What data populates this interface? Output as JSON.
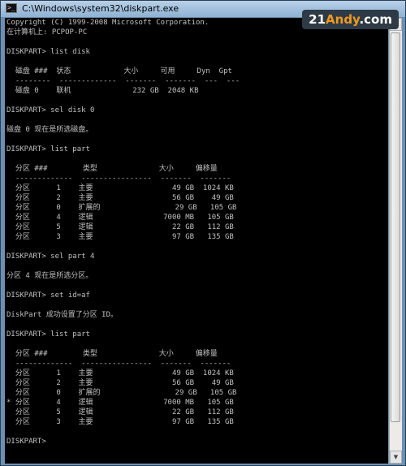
{
  "window": {
    "title": "C:\\Windows\\system32\\diskpart.exe",
    "icon": "cmd-console-icon"
  },
  "watermark": {
    "part1": "21",
    "part2": "Andy",
    "part3": ".com"
  },
  "console": {
    "lines": [
      "Copyright (C) 1999-2008 Microsoft Corporation.",
      "在计算机上: PCPOP-PC",
      "",
      "DISKPART> list disk",
      "",
      "  磁盘 ###  状态            大小     可用     Dyn  Gpt",
      "  --------  -------------  -------  -------  ---  ---",
      "  磁盘 0    联机              232 GB  2048 KB",
      "",
      "DISKPART> sel disk 0",
      "",
      "磁盘 0 现在是所选磁盘。",
      "",
      "DISKPART> list part",
      "",
      "  分区 ###        类型              大小     偏移量",
      "  -------------  ----------------  -------  -------",
      "  分区      1    主要                  49 GB  1024 KB",
      "  分区      2    主要                  56 GB    49 GB",
      "  分区      0    扩展的                 29 GB   105 GB",
      "  分区      4    逻辑                7000 MB   105 GB",
      "  分区      5    逻辑                  22 GB   112 GB",
      "  分区      3    主要                  97 GB   135 GB",
      "",
      "DISKPART> sel part 4",
      "",
      "分区 4 现在是所选分区。",
      "",
      "DISKPART> set id=af",
      "",
      "DiskPart 成功设置了分区 ID。",
      "",
      "DISKPART> list part",
      "",
      "  分区 ###        类型              大小     偏移量",
      "  -------------  ----------------  -------  -------",
      "  分区      1    主要                  49 GB  1024 KB",
      "  分区      2    主要                  56 GB    49 GB",
      "  分区      0    扩展的                 29 GB   105 GB",
      "* 分区      4    逻辑                7000 MB   105 GB",
      "  分区      5    逻辑                  22 GB   112 GB",
      "  分区      3    主要                  97 GB   135 GB",
      "",
      "DISKPART>"
    ]
  },
  "colors": {
    "console_bg": "#000000",
    "console_text": "#c0c0c0",
    "titlebar": "#8fb2d4"
  }
}
